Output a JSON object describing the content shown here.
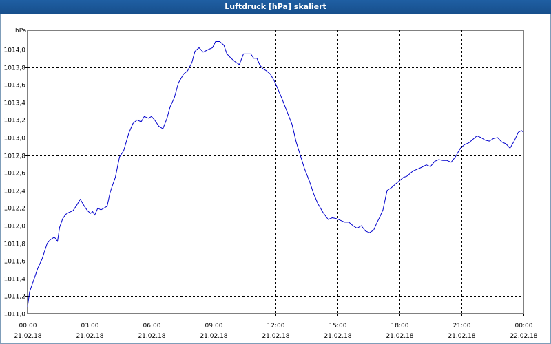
{
  "window": {
    "title": "Luftdruck [hPa] skaliert"
  },
  "colors": {
    "title_bar": "#1a5796",
    "series_line": "#0000cc",
    "grid": "#000000",
    "plot_background": "#ffffff"
  },
  "chart_data": {
    "type": "line",
    "title": "Luftdruck [hPa] skaliert",
    "ylabel": "hPa",
    "xlabel": "",
    "grid": true,
    "grid_style": "dashed",
    "ylim": [
      1011.0,
      1014.2
    ],
    "yticks": [
      "1011,0",
      "1011,2",
      "1011,4",
      "1011,6",
      "1011,8",
      "1012,0",
      "1012,2",
      "1012,4",
      "1012,6",
      "1012,8",
      "1013,0",
      "1013,2",
      "1013,4",
      "1013,6",
      "1013,8",
      "1014,0"
    ],
    "ytick_values": [
      1011.0,
      1011.2,
      1011.4,
      1011.6,
      1011.8,
      1012.0,
      1012.2,
      1012.4,
      1012.6,
      1012.8,
      1013.0,
      1013.2,
      1013.4,
      1013.6,
      1013.8,
      1014.0
    ],
    "xlim_hours": [
      0,
      24
    ],
    "xticks": [
      {
        "hour": 0,
        "time": "00:00",
        "date": "21.02.18"
      },
      {
        "hour": 3,
        "time": "03:00",
        "date": "21.02.18"
      },
      {
        "hour": 6,
        "time": "06:00",
        "date": "21.02.18"
      },
      {
        "hour": 9,
        "time": "09:00",
        "date": "21.02.18"
      },
      {
        "hour": 12,
        "time": "12:00",
        "date": "21.02.18"
      },
      {
        "hour": 15,
        "time": "15:00",
        "date": "21.02.18"
      },
      {
        "hour": 18,
        "time": "18:00",
        "date": "21.02.18"
      },
      {
        "hour": 21,
        "time": "21:00",
        "date": "21.02.18"
      },
      {
        "hour": 24,
        "time": "00:00",
        "date": "22.02.18"
      }
    ],
    "series": [
      {
        "color": "#0000cc",
        "x": [
          0,
          0.1,
          0.25,
          0.5,
          0.7,
          0.95,
          1.1,
          1.3,
          1.45,
          1.55,
          1.7,
          1.85,
          2.0,
          2.2,
          2.4,
          2.55,
          2.75,
          2.9,
          3.05,
          3.15,
          3.25,
          3.4,
          3.55,
          3.7,
          3.85,
          4.0,
          4.1,
          4.25,
          4.45,
          4.65,
          4.9,
          5.1,
          5.3,
          5.5,
          5.65,
          5.85,
          6.0,
          6.15,
          6.35,
          6.55,
          6.75,
          6.9,
          7.1,
          7.3,
          7.55,
          7.75,
          7.95,
          8.1,
          8.3,
          8.5,
          8.75,
          8.95,
          9.1,
          9.3,
          9.5,
          9.65,
          9.85,
          10.05,
          10.25,
          10.45,
          10.65,
          10.8,
          10.95,
          11.1,
          11.25,
          11.4,
          11.55,
          11.75,
          11.95,
          12.1,
          12.3,
          12.55,
          12.8,
          13.0,
          13.2,
          13.4,
          13.65,
          13.85,
          14.05,
          14.3,
          14.55,
          14.75,
          14.95,
          15.15,
          15.35,
          15.55,
          15.75,
          15.95,
          16.15,
          16.35,
          16.55,
          16.75,
          16.9,
          17.05,
          17.2,
          17.4,
          17.6,
          17.8,
          18.0,
          18.2,
          18.35,
          18.5,
          18.65,
          18.85,
          19.05,
          19.3,
          19.5,
          19.7,
          19.9,
          20.1,
          20.3,
          20.5,
          20.7,
          20.95,
          21.15,
          21.35,
          21.55,
          21.75,
          21.95,
          22.15,
          22.35,
          22.55,
          22.75,
          22.95,
          23.15,
          23.35,
          23.55,
          23.75,
          23.9,
          24.0
        ],
        "values": [
          1011.08,
          1011.25,
          1011.35,
          1011.52,
          1011.62,
          1011.8,
          1011.84,
          1011.87,
          1011.82,
          1011.98,
          1012.08,
          1012.13,
          1012.15,
          1012.17,
          1012.24,
          1012.3,
          1012.22,
          1012.17,
          1012.14,
          1012.16,
          1012.12,
          1012.2,
          1012.18,
          1012.2,
          1012.22,
          1012.38,
          1012.45,
          1012.55,
          1012.78,
          1012.85,
          1013.05,
          1013.16,
          1013.2,
          1013.18,
          1013.24,
          1013.22,
          1013.24,
          1013.2,
          1013.13,
          1013.1,
          1013.22,
          1013.35,
          1013.45,
          1013.62,
          1013.72,
          1013.76,
          1013.85,
          1013.98,
          1014.02,
          1013.97,
          1014.0,
          1014.02,
          1014.09,
          1014.09,
          1014.05,
          1013.95,
          1013.9,
          1013.86,
          1013.83,
          1013.95,
          1013.95,
          1013.95,
          1013.9,
          1013.9,
          1013.82,
          1013.78,
          1013.76,
          1013.72,
          1013.64,
          1013.56,
          1013.45,
          1013.3,
          1013.15,
          1012.95,
          1012.8,
          1012.65,
          1012.5,
          1012.36,
          1012.25,
          1012.15,
          1012.07,
          1012.09,
          1012.08,
          1012.06,
          1012.04,
          1012.04,
          1012.0,
          1011.97,
          1012.0,
          1011.94,
          1011.92,
          1011.95,
          1012.03,
          1012.1,
          1012.18,
          1012.4,
          1012.43,
          1012.47,
          1012.51,
          1012.55,
          1012.56,
          1012.59,
          1012.62,
          1012.64,
          1012.66,
          1012.69,
          1012.67,
          1012.73,
          1012.75,
          1012.74,
          1012.74,
          1012.72,
          1012.78,
          1012.88,
          1012.92,
          1012.94,
          1012.98,
          1013.02,
          1013.0,
          1012.97,
          1012.96,
          1012.99,
          1013.0,
          1012.95,
          1012.93,
          1012.88,
          1012.96,
          1013.06,
          1013.08,
          1013.06
        ]
      }
    ]
  }
}
